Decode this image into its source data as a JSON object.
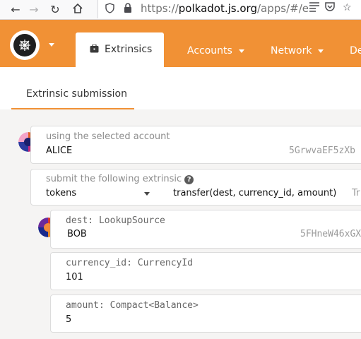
{
  "browser": {
    "url_scheme": "https://",
    "url_host": "polkadot.js.org",
    "url_path": "/apps/#/e"
  },
  "nav": {
    "active_tab": "Extrinsics",
    "items": [
      "Accounts",
      "Network",
      "De"
    ]
  },
  "subnav": {
    "tab": "Extrinsic submission"
  },
  "account": {
    "label": "using the selected account",
    "name": "ALICE",
    "address": "5GrwvaEF5zXb"
  },
  "extrinsic": {
    "label": "submit the following extrinsic",
    "help": "?",
    "module": "tokens",
    "method": "transfer(dest, currency_id, amount)",
    "hint": "Tr"
  },
  "params": {
    "dest": {
      "label": "dest: LookupSource",
      "name": "BOB",
      "address": "5FHneW46xGX"
    },
    "currency_id": {
      "label": "currency_id: CurrencyId",
      "value": "101"
    },
    "amount": {
      "label": "amount: Compact<Balance>",
      "value": "5"
    }
  }
}
